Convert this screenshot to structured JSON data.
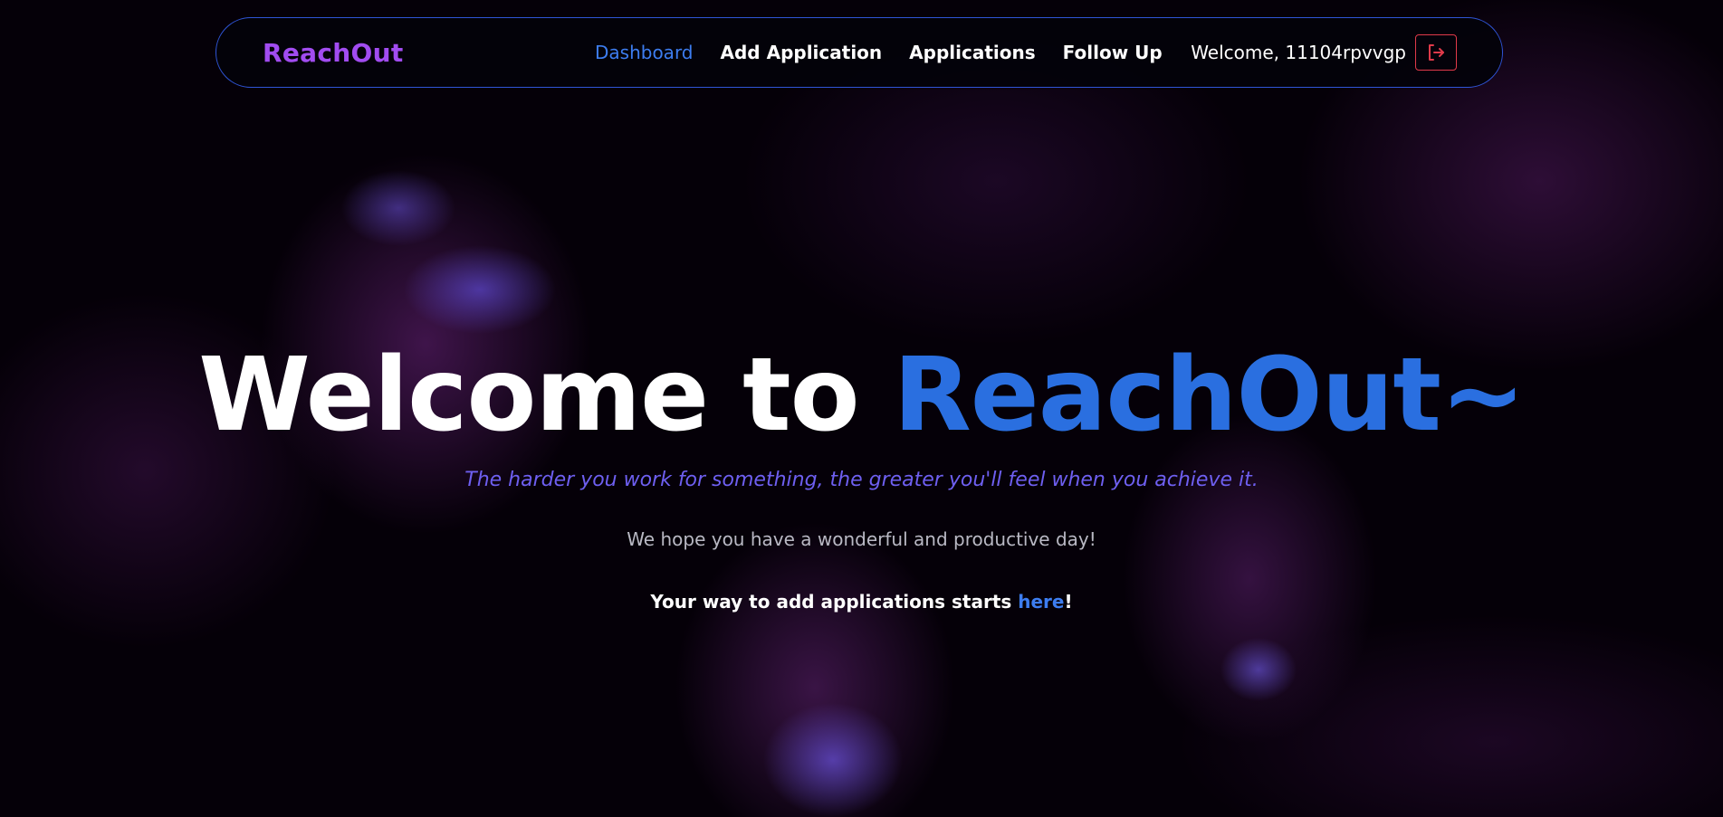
{
  "nav": {
    "brand": "ReachOut",
    "links": [
      {
        "label": "Dashboard",
        "active": true
      },
      {
        "label": "Add Application",
        "active": false
      },
      {
        "label": "Applications",
        "active": false
      },
      {
        "label": "Follow Up",
        "active": false
      }
    ],
    "welcome": "Welcome, 11104rpvvgp",
    "logout_icon": "logout-icon"
  },
  "hero": {
    "title_prefix": "Welcome to ",
    "title_accent": "ReachOut~",
    "tagline": "The harder you work for something, the greater you'll feel when you achieve it.",
    "subtitle": "We hope you have a wonderful and productive day!",
    "cta_prefix": "Your way to add applications starts ",
    "cta_link": "here",
    "cta_suffix": "!"
  },
  "colors": {
    "brand": "#a14cf0",
    "accent_blue": "#2a6fe0",
    "link_blue": "#3d7df0",
    "tagline_purple": "#6e5ff0",
    "logout_red": "#e03a4a",
    "nav_border": "#2f54d6"
  }
}
